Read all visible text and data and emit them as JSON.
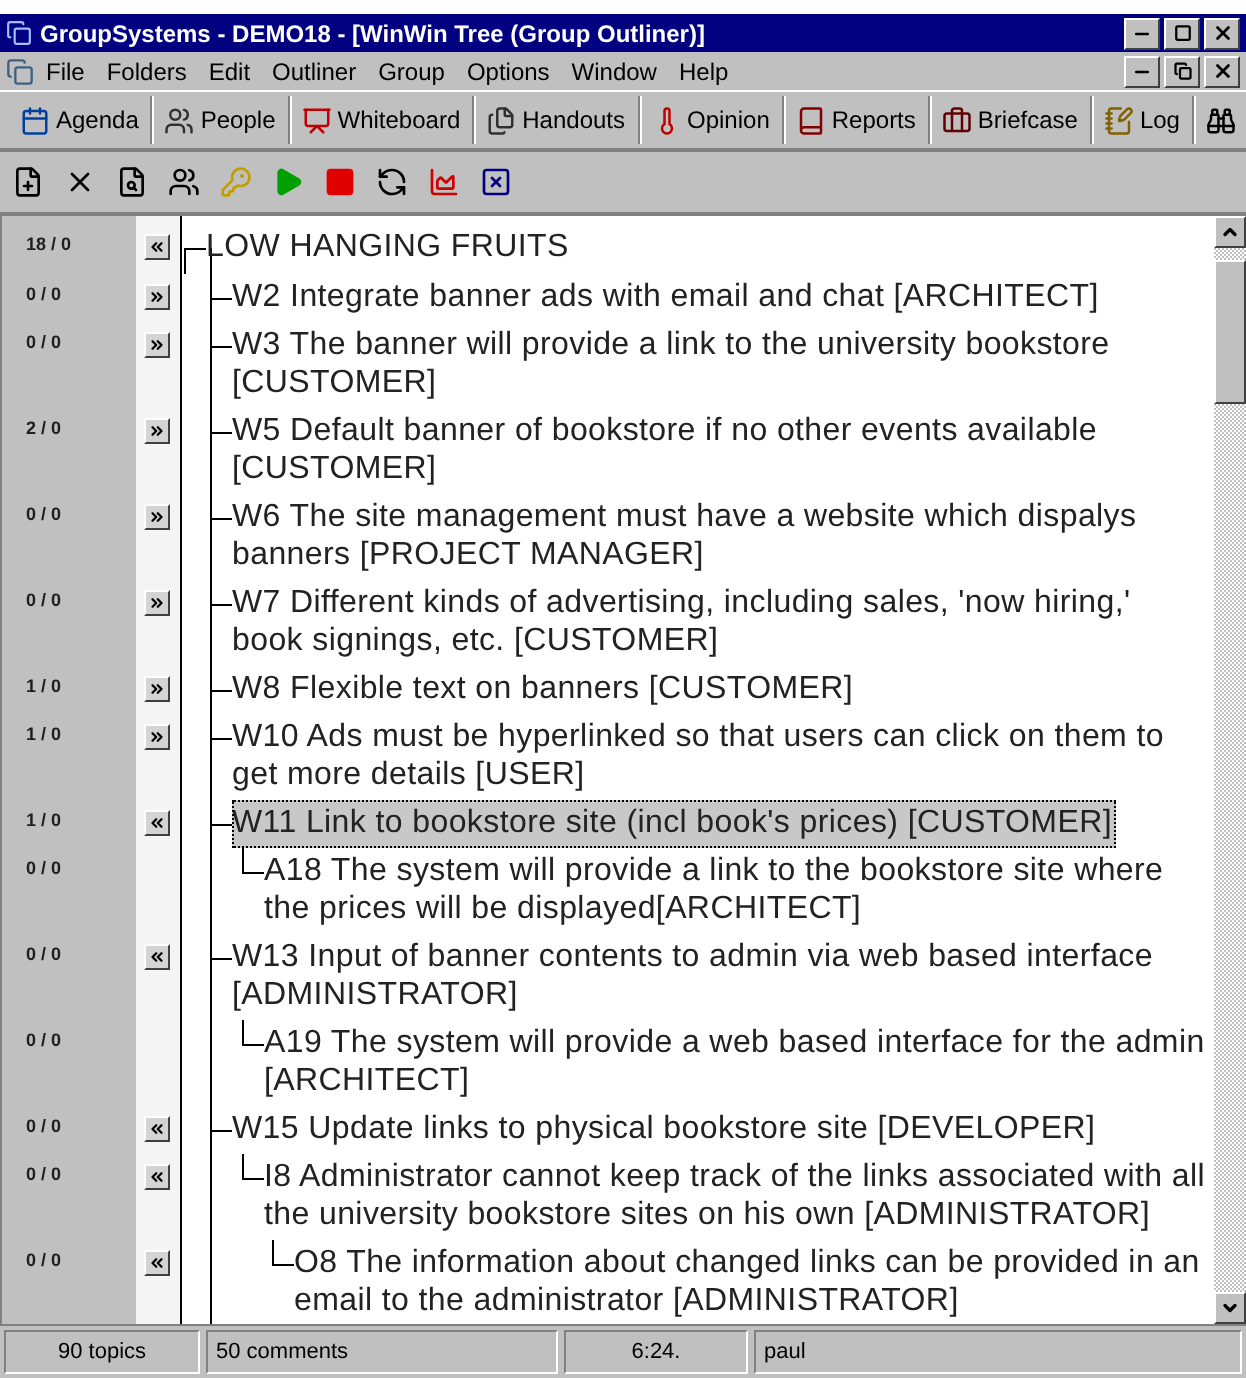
{
  "window": {
    "title": "GroupSystems - DEMO18 - [WinWin Tree (Group Outliner)]"
  },
  "menu": [
    "File",
    "Folders",
    "Edit",
    "Outliner",
    "Group",
    "Options",
    "Window",
    "Help"
  ],
  "toolbar": [
    {
      "label": "Agenda",
      "kind": "agenda"
    },
    {
      "label": "People",
      "kind": "people"
    },
    {
      "label": "Whiteboard",
      "kind": "whiteboard"
    },
    {
      "label": "Handouts",
      "kind": "handouts"
    },
    {
      "label": "Opinion",
      "kind": "opinion"
    },
    {
      "label": "Reports",
      "kind": "reports"
    },
    {
      "label": "Briefcase",
      "kind": "briefcase"
    },
    {
      "label": "Log",
      "kind": "log"
    },
    {
      "kind": "binoculars"
    }
  ],
  "outline": {
    "text": "LOW HANGING FRUITS",
    "counts": "18 / 0",
    "expanded": true,
    "selected": false,
    "children": [
      {
        "text": "W2 Integrate banner ads with email and chat [ARCHITECT]",
        "counts": "0 / 0",
        "expanded": false,
        "selected": false
      },
      {
        "text": "W3 The banner will provide a link to the university bookstore [CUSTOMER]",
        "counts": "0 / 0",
        "expanded": false,
        "selected": false
      },
      {
        "text": "W5 Default banner of bookstore if no other events available [CUSTOMER]",
        "counts": "2 / 0",
        "expanded": false,
        "selected": false
      },
      {
        "text": "W6 The site management must have a website  which dispalys banners [PROJECT MANAGER]",
        "counts": "0 / 0",
        "expanded": false,
        "selected": false
      },
      {
        "text": "W7 Different kinds of advertising, including sales, 'now hiring,' book signings, etc. [CUSTOMER]",
        "counts": "0 / 0",
        "expanded": false,
        "selected": false
      },
      {
        "text": "W8 Flexible text on banners [CUSTOMER]",
        "counts": "1 / 0",
        "expanded": false,
        "selected": false
      },
      {
        "text": "W10 Ads must be hyperlinked so that users can click on them to get more details [USER]",
        "counts": "1 / 0",
        "expanded": false,
        "selected": false
      },
      {
        "text": "W11 Link to bookstore site (incl book's prices) [CUSTOMER]",
        "counts": "1 / 0",
        "expanded": true,
        "selected": true,
        "children": [
          {
            "text": "A18 The system will provide a link to the bookstore site where the prices will be displayed[ARCHITECT]",
            "counts": "0 / 0",
            "selected": false
          }
        ]
      },
      {
        "text": "W13 Input of banner contents to admin via web based interface [ADMINISTRATOR]",
        "counts": "0 / 0",
        "expanded": true,
        "selected": false,
        "children": [
          {
            "text": "A19 The system will provide a web based interface for the admin [ARCHITECT]",
            "counts": "0 / 0",
            "selected": false
          }
        ]
      },
      {
        "text": "W15 Update links to physical bookstore site [DEVELOPER]",
        "counts": "0 / 0",
        "expanded": true,
        "selected": false,
        "children": [
          {
            "text": "I8 Administrator cannot keep track of the links associated with all the university bookstore sites on his own [ADMINISTRATOR]",
            "counts": "0 / 0",
            "expanded": true,
            "selected": false,
            "children": [
              {
                "text": "O8 The information about changed links can be provided in an email to the administrator [ADMINISTRATOR]",
                "counts": "0 / 0",
                "expanded": true,
                "selected": false
              }
            ]
          }
        ]
      }
    ]
  },
  "status_bar": [
    "90 topics",
    "50 comments",
    "6:24.",
    "paul"
  ]
}
